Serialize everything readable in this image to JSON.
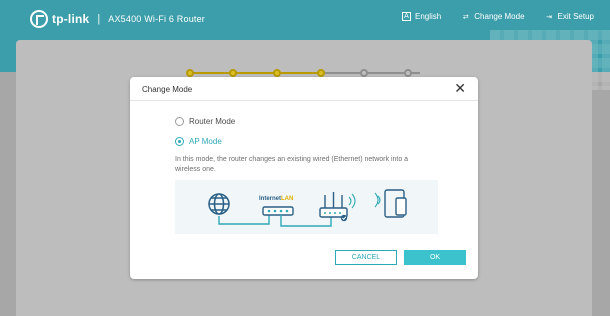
{
  "header": {
    "brand": "tp-link",
    "separator": "|",
    "model": "AX5400 Wi-Fi 6 Router",
    "actions": [
      {
        "icon": "language-icon",
        "label": "English"
      },
      {
        "icon": "change-mode-icon",
        "label": "Change Mode"
      },
      {
        "icon": "exit-icon",
        "label": "Exit Setup"
      }
    ]
  },
  "stepper": {
    "steps": [
      {
        "state": "done"
      },
      {
        "state": "done"
      },
      {
        "state": "done"
      },
      {
        "state": "done"
      },
      {
        "state": "pending"
      },
      {
        "state": "pending"
      }
    ]
  },
  "modal": {
    "title": "Change Mode",
    "close_icon": "close-icon",
    "options": [
      {
        "label": "Router Mode",
        "selected": false
      },
      {
        "label": "AP Mode",
        "selected": true
      }
    ],
    "description": "In this mode, the router changes an existing wired (Ethernet) network into a wireless one.",
    "diagram": {
      "labels": {
        "internet": "Internet",
        "lan": "LAN"
      }
    },
    "buttons": {
      "cancel": "CANCEL",
      "ok": "OK"
    }
  },
  "colors": {
    "header_bg": "#3b9eaa",
    "overlay_bg": "#a7a7a7",
    "accent": "#2fa9b6",
    "ok_button": "#3cc2cc",
    "step_done": "#d9bf1f"
  }
}
